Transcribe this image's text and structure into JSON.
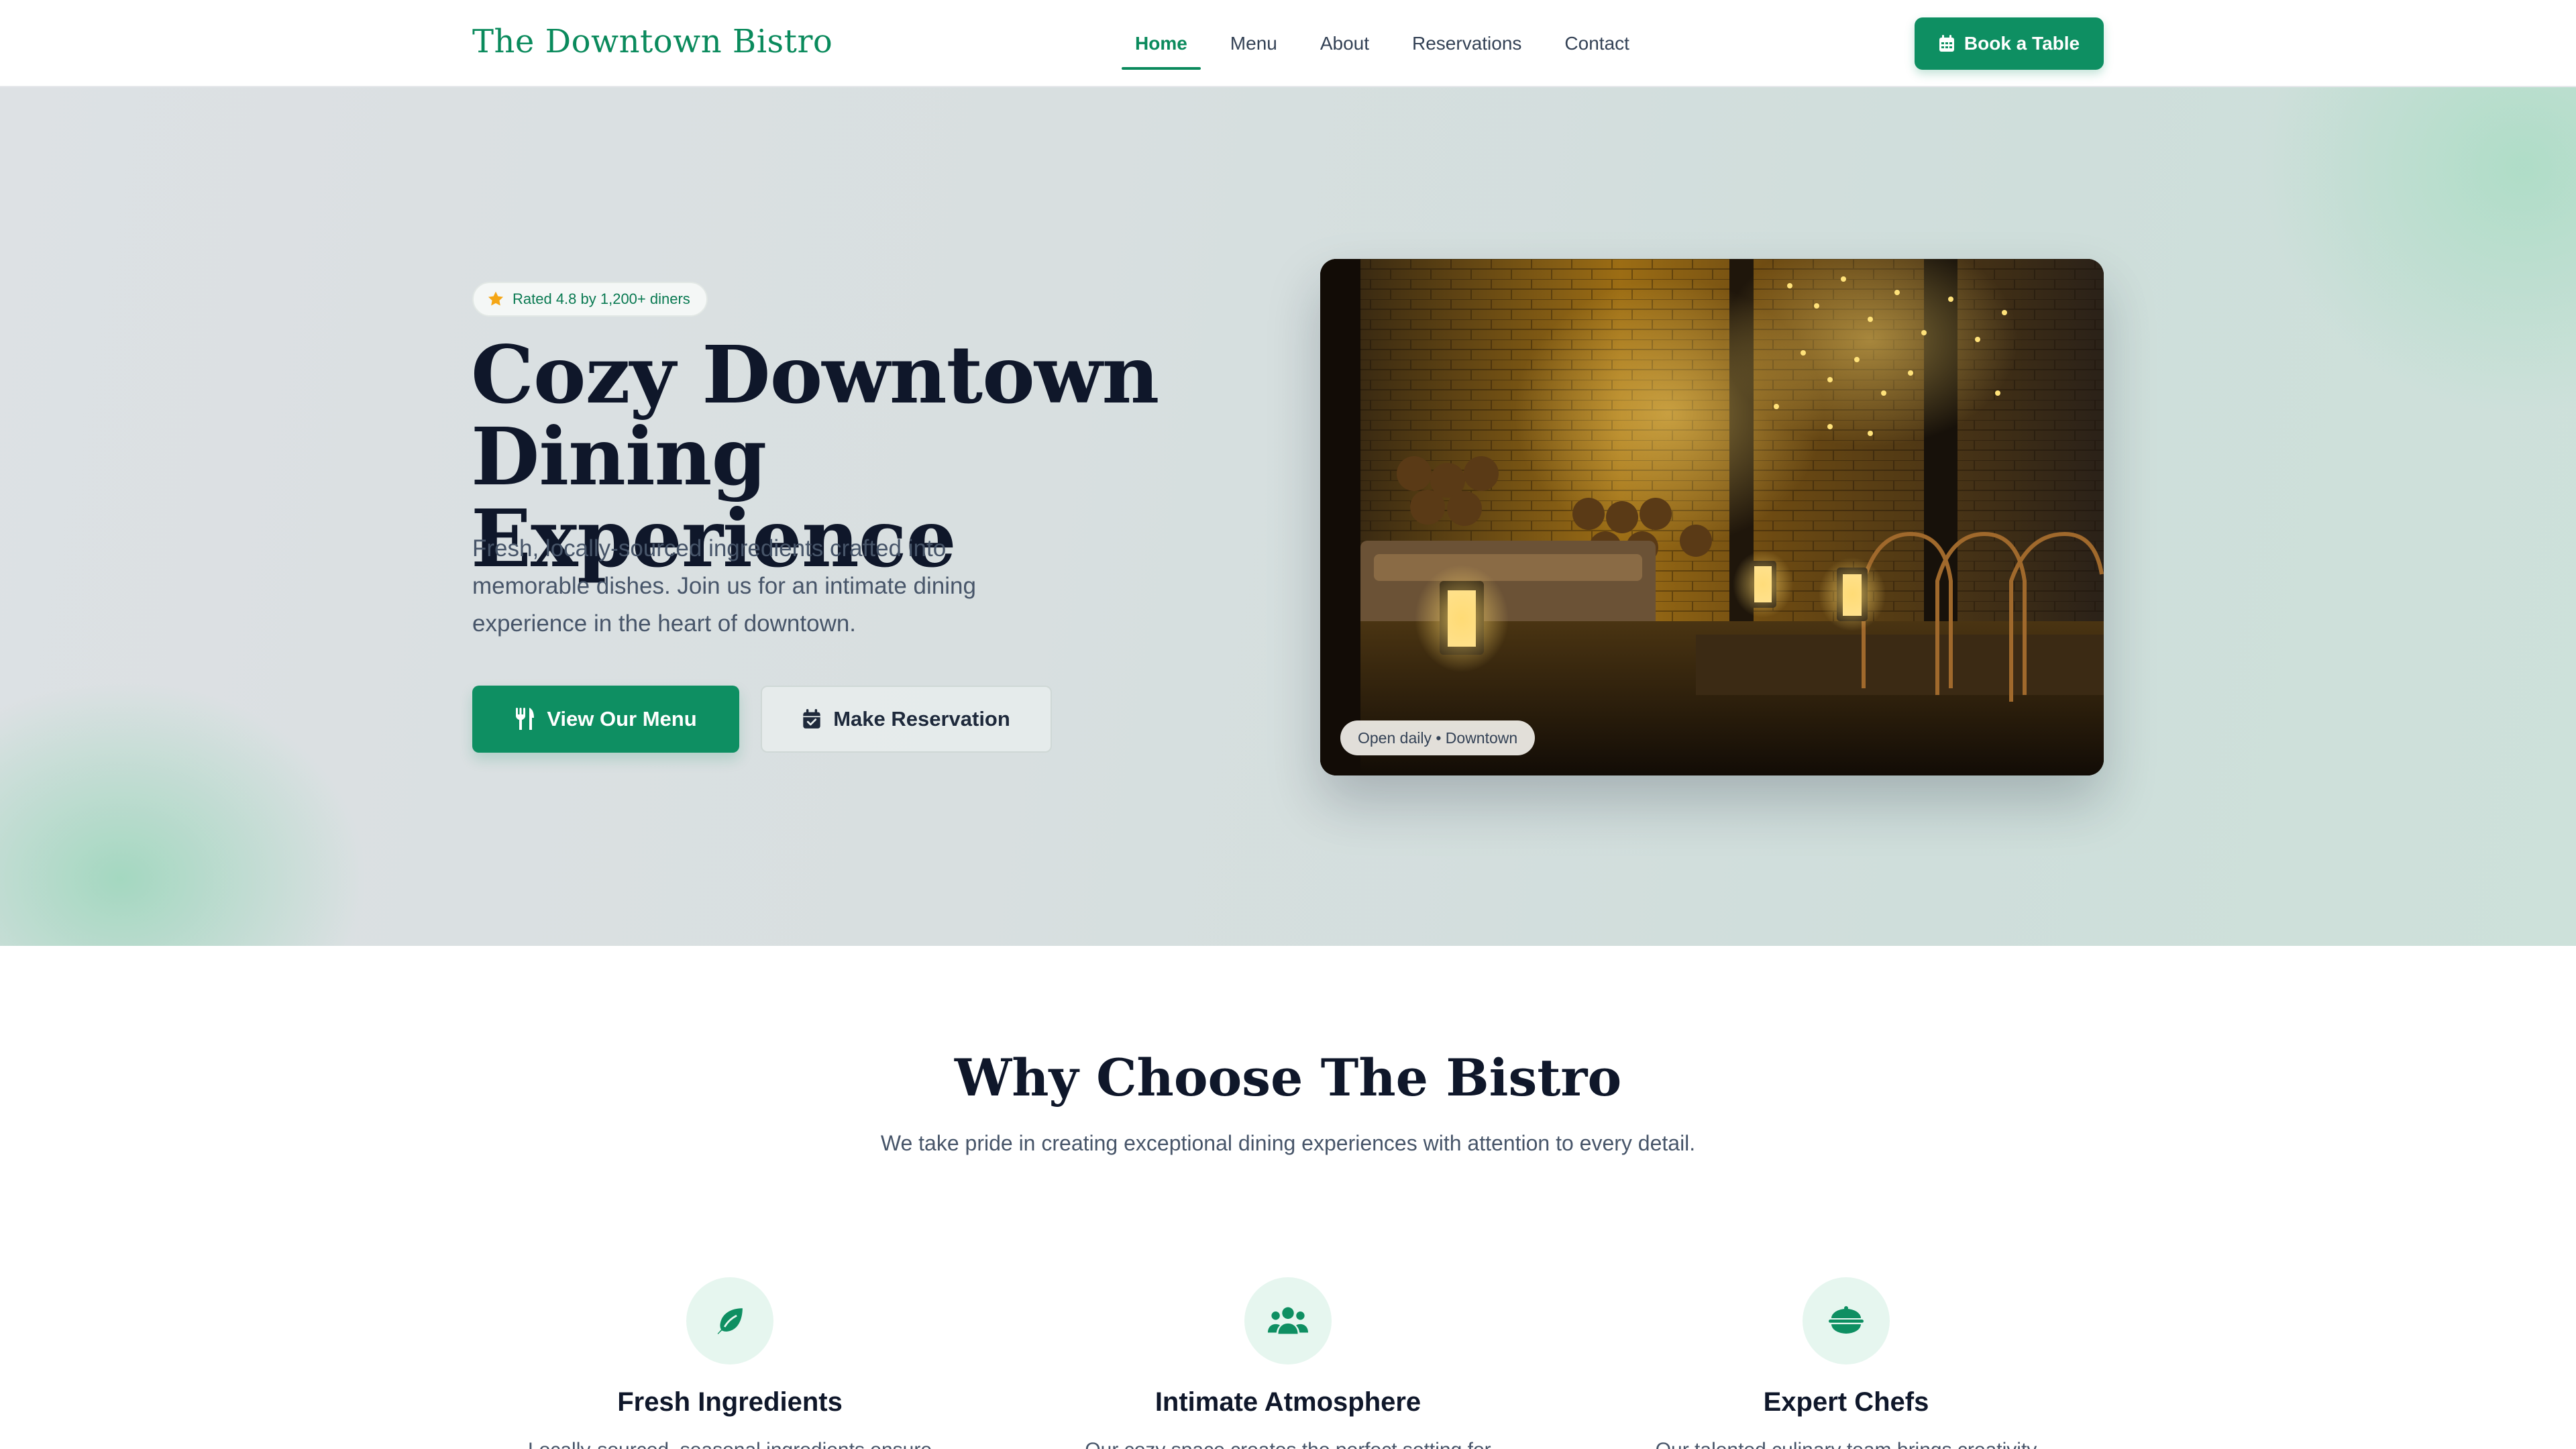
{
  "nav": {
    "brand": "The Downtown Bistro",
    "links": [
      "Home",
      "Menu",
      "About",
      "Reservations",
      "Contact"
    ],
    "active": "Home",
    "cta": "Book a Table",
    "cta_icon": "calendar-icon"
  },
  "hero": {
    "badge": "Rated 4.8 by 1,200+ diners",
    "badge_icon": "star-icon",
    "title_line1": "Cozy Downtown",
    "title_line2": "Dining Experience",
    "subtitle": "Fresh, locally-sourced ingredients crafted into memorable dishes. Join us for an intimate dining experience in the heart of downtown.",
    "primary_button": "View Our Menu",
    "primary_icon": "utensils-icon",
    "secondary_button": "Make Reservation",
    "secondary_icon": "calendar-check-icon",
    "image_caption": "Open daily • Downtown"
  },
  "features": {
    "title": "Why Choose The Bistro",
    "subtitle": "We take pride in creating exceptional dining experiences with attention to every detail.",
    "items": [
      {
        "icon": "leaf-icon",
        "title": "Fresh Ingredients",
        "desc": "Locally-sourced, seasonal ingredients ensure"
      },
      {
        "icon": "users-icon",
        "title": "Intimate Atmosphere",
        "desc": "Our cozy space creates the perfect setting for"
      },
      {
        "icon": "bowl-icon",
        "title": "Expert Chefs",
        "desc": "Our talented culinary team brings creativity and"
      }
    ]
  },
  "colors": {
    "brand": "#0a8a5c",
    "button": "#0e8f62",
    "text": "#0f172a",
    "muted": "#475569"
  }
}
